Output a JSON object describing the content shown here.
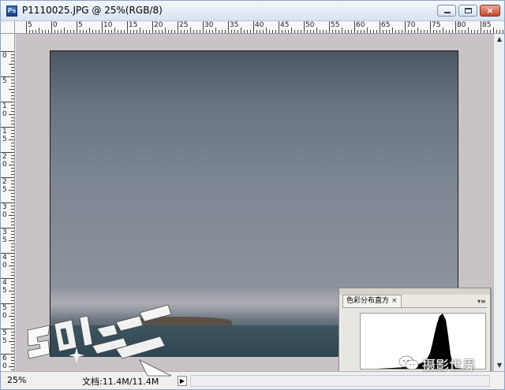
{
  "window": {
    "title": "P1110025.JPG @ 25%(RGB/8)",
    "app_icon_text": "Ps",
    "controls": {
      "minimize": "minimize",
      "maximize": "maximize",
      "close": "×"
    }
  },
  "ruler": {
    "top_labels": [
      "5",
      "0",
      "5",
      "10",
      "15",
      "20",
      "25",
      "30",
      "35",
      "40",
      "45",
      "50",
      "55",
      "60",
      "65",
      "70",
      "75",
      "80",
      "85"
    ],
    "left_labels": [
      "0",
      "5",
      "1 0",
      "1 5",
      "2 0",
      "2 5",
      "3 0",
      "3 5",
      "4 0",
      "4 5",
      "5 0",
      "5 5",
      "6 0"
    ]
  },
  "status": {
    "zoom": "25%",
    "doc_info": "文档:11.4M/11.4M",
    "arrow": "▶"
  },
  "histogram_panel": {
    "tab_label": "色彩分布直方",
    "close": "×",
    "menu_icon": "▾≡"
  },
  "watermark": {
    "logo_text": "501 DIGI PHOTO",
    "weixin_text": "摄影世界"
  },
  "colors": {
    "canvas_bg": "#c9c3c7",
    "titlebar": "#d6e3f1",
    "close_button": "#c8432b"
  }
}
